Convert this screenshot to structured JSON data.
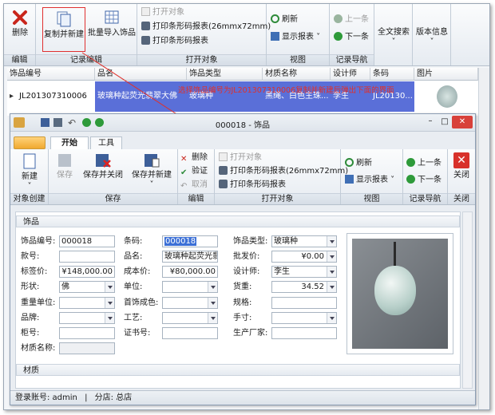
{
  "main": {
    "ribbon": {
      "delete": "删除",
      "copy_new": "复制并新建",
      "batch_import": "批量导入饰品",
      "open_obj": "打开对象",
      "print1": "打印条形码报表(26mmx72mm)",
      "print2": "打印条形码报表",
      "refresh": "刷新",
      "show_report": "显示报表",
      "prev": "上一条",
      "next": "下一条",
      "fulltext": "全文搜索",
      "version": "版本信息",
      "g_edit": "编辑",
      "g_record_edit": "记录编辑",
      "g_open": "打开对象",
      "g_view": "视图",
      "g_nav": "记录导航"
    },
    "grid": {
      "headers": [
        "饰品编号",
        "品名",
        "饰品类型",
        "材质名称",
        "设计师",
        "条码",
        "图片"
      ],
      "row": [
        "JL201307310006",
        "玻璃种起荧光翡翠大佛",
        "玻璃种",
        "黑绳、白色主珠...",
        "李生",
        "JL20130..."
      ]
    },
    "annotation": "选择饰品编号为JL201307310006复制并新建后弹出下面的界面"
  },
  "child": {
    "title": "000018 - 饰品",
    "tabs": [
      "开始",
      "工具"
    ],
    "ribbon": {
      "new": "新建",
      "save": "保存",
      "save_close": "保存并关闭",
      "save_new": "保存并新建",
      "delete": "删除",
      "verify": "验证",
      "cancel": "取消",
      "open_obj": "打开对象",
      "print1": "打印条形码报表(26mmx72mm)",
      "print2": "打印条形码报表",
      "refresh": "刷新",
      "show_report": "显示报表",
      "prev": "上一条",
      "next": "下一条",
      "close": "关闭",
      "g_create": "对象创建",
      "g_save": "保存",
      "g_edit": "编辑",
      "g_open": "打开对象",
      "g_view": "视图",
      "g_nav": "记录导航",
      "g_close": "关闭"
    },
    "section1": "饰品",
    "section2": "材质",
    "labels": {
      "code": "饰品编号:",
      "style": "款号:",
      "tag_price": "标签价:",
      "shape": "形状:",
      "weight_unit": "重量单位:",
      "brand": "品牌:",
      "cabinet": "柜号:",
      "material": "材质名称:",
      "barcode": "条码:",
      "name": "品名:",
      "cost": "成本价:",
      "unit": "单位:",
      "finish": "首饰成色:",
      "craft": "工艺:",
      "cert": "证书号:",
      "type": "饰品类型:",
      "wholesale": "批发价:",
      "designer": "设计师:",
      "goods_weight": "货重:",
      "spec": "规格:",
      "hand": "手寸:",
      "maker": "生产厂家:"
    },
    "values": {
      "code": "000018",
      "tag_price": "¥148,000.00",
      "shape": "佛",
      "barcode": "000018",
      "name": "玻璃种起荧光翡翠",
      "cost": "¥80,000.00",
      "type": "玻璃种",
      "wholesale": "¥0.00",
      "designer": "李生",
      "goods_weight": "34.52"
    },
    "status": {
      "account": "登录账号: admin",
      "sep": "|",
      "branch": "分店: 总店"
    }
  },
  "colors": {
    "selection": "#5a6fd8",
    "annotation": "#e0302a",
    "highlight_box": "#e03030"
  }
}
